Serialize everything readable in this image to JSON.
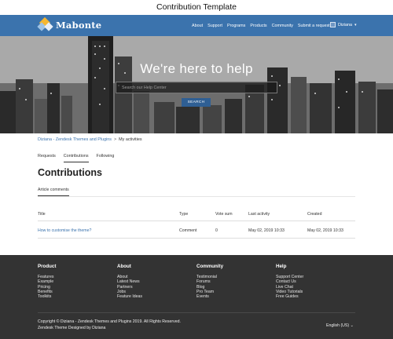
{
  "window_title": "Contribution Template",
  "navbar": {
    "brand": "Mabonte",
    "links": [
      "About",
      "Support",
      "Programs",
      "Products",
      "Community",
      "Submit a request"
    ],
    "user_name": "Diziana",
    "user_chevron": "▾"
  },
  "hero": {
    "title": "We're here to help",
    "search_placeholder": "Search our Help Center",
    "search_button": "SEARCH"
  },
  "breadcrumb": {
    "items": [
      "Diziana - Zendesk Themes and Plugins",
      "My activities"
    ],
    "separator": ">"
  },
  "tabs": [
    {
      "label": "Requests",
      "active": false
    },
    {
      "label": "Contributions",
      "active": true
    },
    {
      "label": "Following",
      "active": false
    }
  ],
  "page_title": "Contributions",
  "subtab": "Article comments",
  "table": {
    "headers": [
      "Title",
      "Type",
      "Vote sum",
      "Last activity",
      "Created"
    ],
    "rows": [
      [
        "How to customise the theme?",
        "Comment",
        "0",
        "May 02, 2019 10:33",
        "May 02, 2019 10:33"
      ]
    ]
  },
  "footer": {
    "columns": [
      {
        "heading": "Product",
        "links": [
          "Features",
          "Example",
          "Pricing",
          "Benefits",
          "Toolkits"
        ]
      },
      {
        "heading": "About",
        "links": [
          "About",
          "Latest News",
          "Partners",
          "Jobs",
          "Feature Ideas"
        ]
      },
      {
        "heading": "Community",
        "links": [
          "Testimonial",
          "Forums",
          "Blog",
          "Pro Team",
          "Events"
        ]
      },
      {
        "heading": "Help",
        "links": [
          "Support Center",
          "Contact Us",
          "Live Chat",
          "Video Tutorials",
          "Free Guides"
        ]
      }
    ],
    "copyright": "Copyright © Diziana - Zendesk Themes and Plugins 2019. All Rights Reserved.",
    "designer": "Zendesk Theme Designed by Diziana",
    "language": "English (US)",
    "language_chevron": "⌄"
  },
  "colors": {
    "navbar": "#3b73ad",
    "accent_link": "#3b73ad",
    "button": "#2f5f94",
    "footer": "#333333"
  },
  "icons": {
    "logo": "diamond-logo-icon",
    "user": "user-avatar-icon",
    "dropdown": "chevron-down-icon"
  }
}
